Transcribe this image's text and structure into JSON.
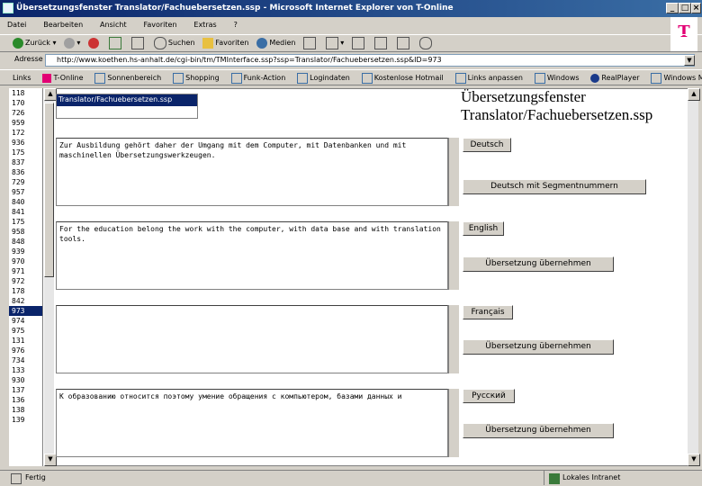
{
  "window": {
    "title": "Übersetzungsfenster Translator/Fachuebersetzen.ssp - Microsoft Internet Explorer von T-Online",
    "controls": [
      "_",
      "□",
      "×"
    ]
  },
  "menu": [
    "Datei",
    "Bearbeiten",
    "Ansicht",
    "Favoriten",
    "Extras",
    "?"
  ],
  "toolbar": {
    "back": "Zurück",
    "search": "Suchen",
    "favorites": "Favoriten",
    "media": "Medien"
  },
  "address": {
    "label": "Adresse",
    "url": "http://www.koethen.hs-anhalt.de/cgi-bin/tm/TMInterface.ssp?ssp=Translator/Fachuebersetzen.ssp&ID=973"
  },
  "links": {
    "label": "Links",
    "items": [
      "T-Online",
      "Sonnenbereich",
      "Shopping",
      "Funk-Action",
      "Logindaten",
      "Kostenlose Hotmail",
      "Links anpassen",
      "Windows",
      "RealPlayer",
      "Windows Media"
    ]
  },
  "brand": "T",
  "left_list": [
    "118",
    "170",
    "726",
    "959",
    "172",
    "936",
    "175",
    "837",
    "836",
    "729",
    "957",
    "840",
    "841",
    "175",
    "958",
    "848",
    "939",
    "970",
    "971",
    "972",
    "178",
    "842",
    "973",
    "974",
    "975",
    "131",
    "976",
    "734",
    "133",
    "930",
    "137",
    "136",
    "138",
    "139"
  ],
  "left_list_selected_index": 22,
  "path_list": {
    "selected": "Translator/Fachuebersetzen.ssp"
  },
  "heading": {
    "line1": "Übersetzungsfenster",
    "line2": "Translator/Fachuebersetzen.ssp"
  },
  "panels": [
    {
      "text": "Zur Ausbildung gehört daher der Umgang mit dem Computer, mit Datenbanken und mit maschinellen Übersetzungswerkzeugen.",
      "lang_button": "Deutsch",
      "action_button": "Deutsch mit Segmentnummern"
    },
    {
      "text": "For the education belong the work with the computer, with data base and with translation tools.",
      "lang_button": "English",
      "action_button": "Übersetzung übernehmen"
    },
    {
      "text": "",
      "lang_button": "Français",
      "action_button": "Übersetzung übernehmen"
    },
    {
      "text": "К образованию относится поэтому умение обращения с компьютером, базами данных и",
      "lang_button": "Русский",
      "action_button": "Übersetzung übernehmen"
    }
  ],
  "status": {
    "left": "Fertig",
    "zone": "Lokales Intranet"
  }
}
